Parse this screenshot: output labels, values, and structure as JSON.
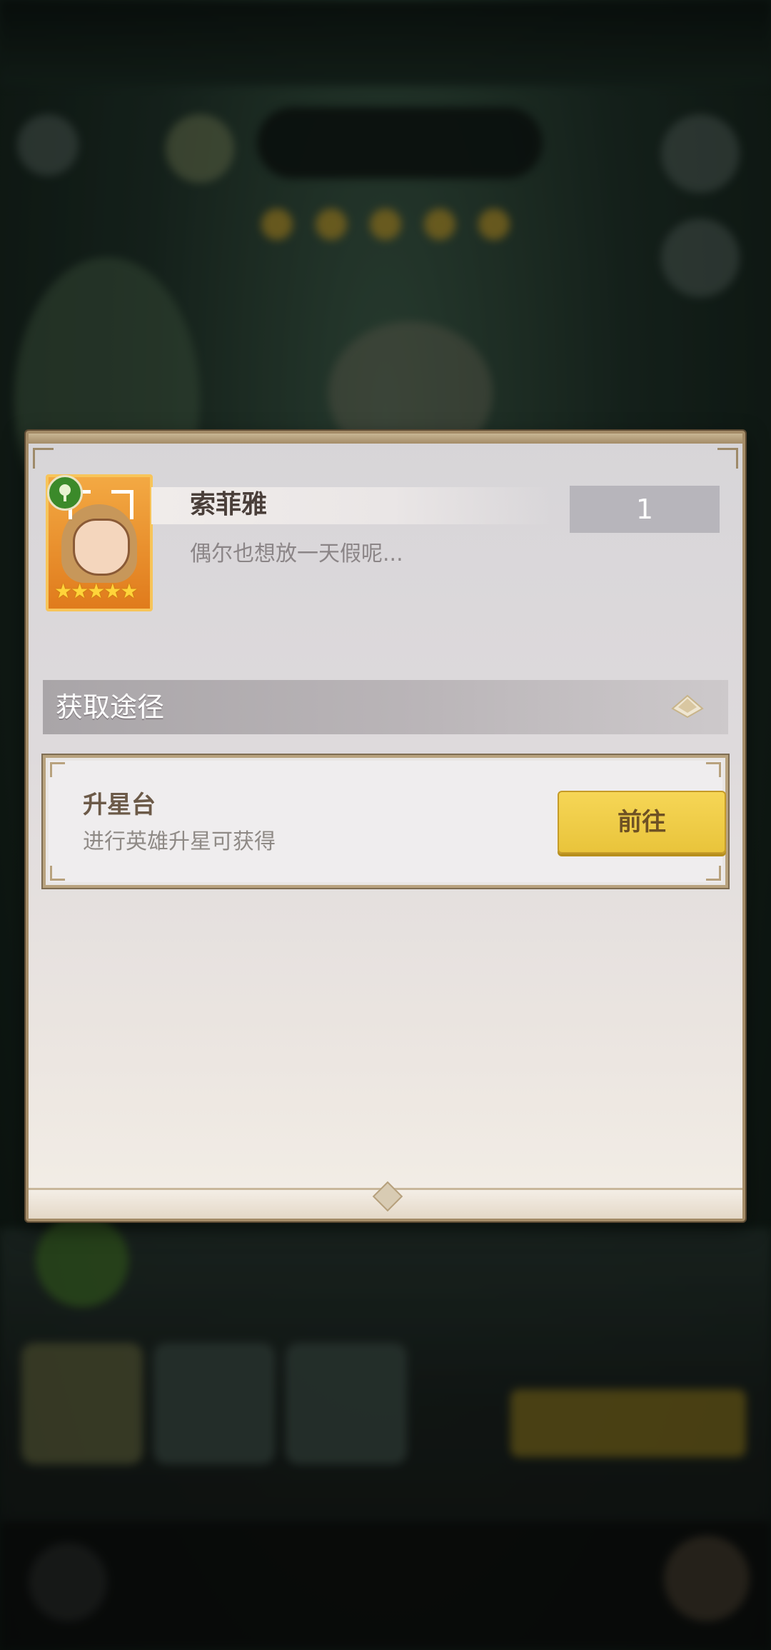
{
  "hero": {
    "name": "索菲雅",
    "count": "1",
    "description": "偶尔也想放一天假呢...",
    "stars": "★★★★★",
    "faction_icon": "tree-icon"
  },
  "obtain": {
    "title": "获取途径",
    "toggle_icon": "diamond-pyramid-icon"
  },
  "sources": [
    {
      "title": "升星台",
      "subtitle": "进行英雄升星可获得",
      "button_label": "前往"
    }
  ],
  "colors": {
    "accent_button": "#f0cf4a",
    "frame": "#a48c68",
    "hero_frame": "#f3a943"
  }
}
